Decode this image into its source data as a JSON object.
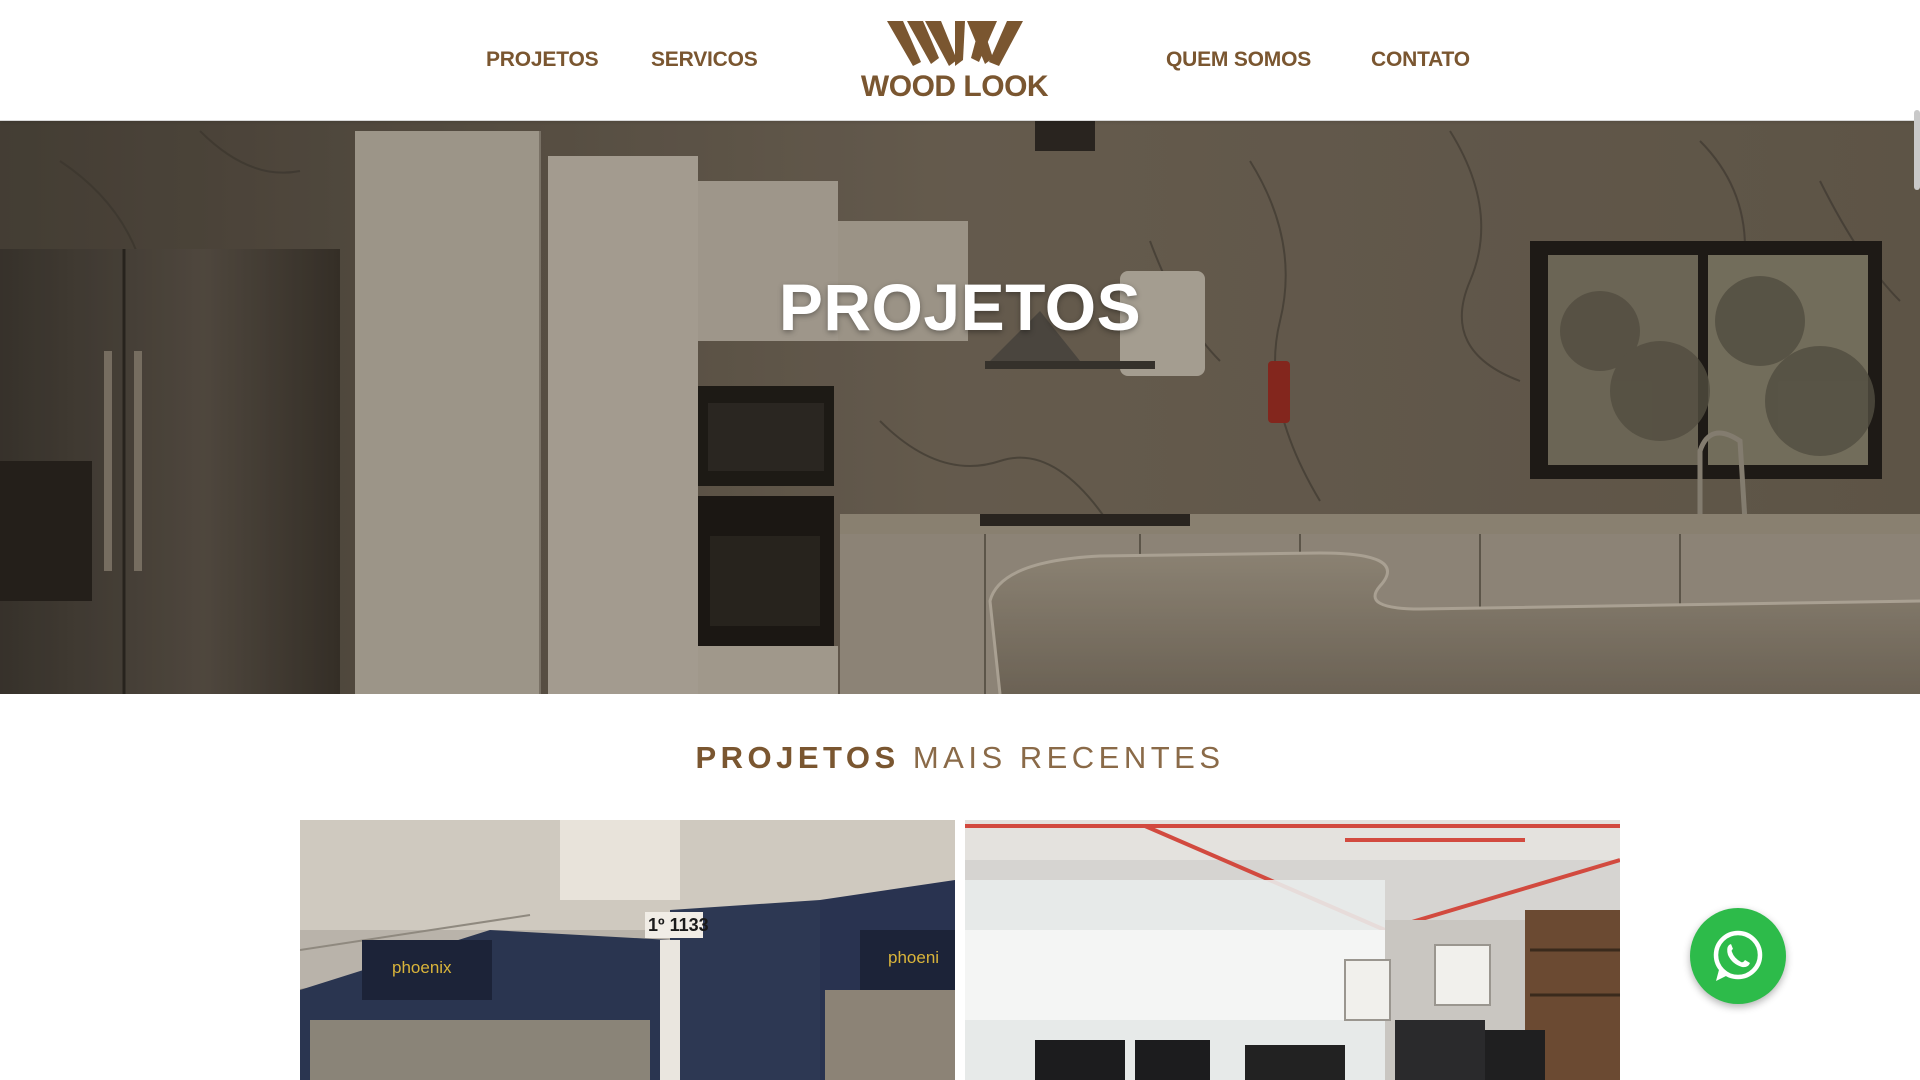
{
  "nav": {
    "left": [
      {
        "label": "PROJETOS"
      },
      {
        "label": "SERVICOS"
      }
    ],
    "right": [
      {
        "label": "QUEM SOMOS"
      },
      {
        "label": "CONTATO"
      }
    ],
    "logo_text": "WOOD LOOK"
  },
  "hero": {
    "title": "PROJETOS"
  },
  "section": {
    "title_strong": "PROJETOS",
    "title_light": "MAIS RECENTES"
  },
  "cards": {
    "store_number": "1º 1133",
    "store_sign": "phoenix",
    "store_sign_2": "phoeni"
  },
  "icons": {
    "whatsapp": "whatsapp-icon",
    "logo_mark": "wood-look-logo-mark"
  },
  "colors": {
    "brand": "#7a5630",
    "whatsapp": "#2dbb4a",
    "store_blue": "#2a3550",
    "sign_gold": "#d9b43a"
  }
}
